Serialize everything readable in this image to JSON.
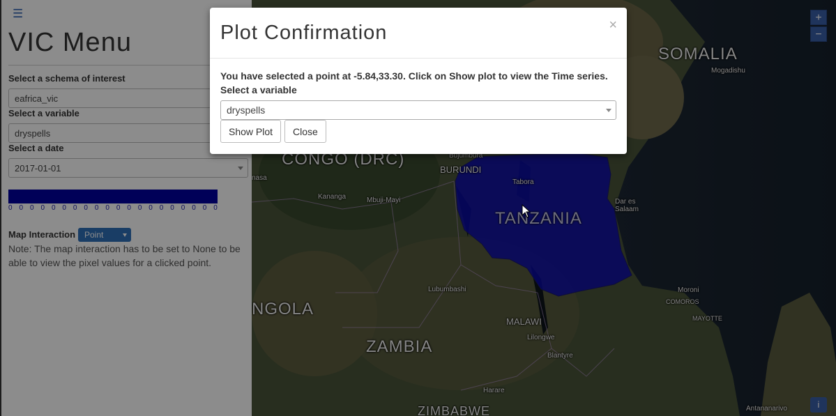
{
  "sidebar": {
    "title": "VIC Menu",
    "schema_label": "Select a schema of interest",
    "schema_value": "eafrica_vic",
    "variable_label": "Select a variable",
    "variable_value": "dryspells",
    "date_label": "Select a date",
    "date_value": "2017-01-01",
    "legend_color": "#0000a0",
    "legend_ticks": [
      "0",
      "0",
      "0",
      "0",
      "0",
      "0",
      "0",
      "0",
      "0",
      "0",
      "0",
      "0",
      "0",
      "0",
      "0",
      "0",
      "0",
      "0",
      "0",
      "0"
    ],
    "map_interaction_label": "Map Interaction",
    "map_interaction_value": "Point",
    "note": "Note: The map interaction has to be set to None to be able to view the pixel values for a clicked point."
  },
  "map": {
    "zoom_in": "+",
    "zoom_out": "−",
    "info": "i",
    "countries": {
      "somalia": "SOMALIA",
      "congo": "CONGO (DRC)",
      "burundi": "BURUNDI",
      "tanzania": "TANZANIA",
      "angola": "NGOLA",
      "zambia": "ZAMBIA",
      "malawi": "MALAWI",
      "comoros": "COMOROS",
      "zimbabwe": "ZIMBABWE"
    },
    "cities": {
      "mogadishu": "Mogadishu",
      "bujumbura": "Bujumbura",
      "tabora": "Tabora",
      "kananga": "Kananga",
      "mbuji_mayi": "Mbuji-Mayi",
      "dar_es_salaam": "Dar es\nSalaam",
      "lubumbashi": "Lubumbashi",
      "lilongwe": "Lilongwe",
      "blantyre": "Blantyre",
      "moroni": "Moroni",
      "mayotte": "MAYOTTE",
      "harare": "Harare",
      "antananarivo": "Antananarivo",
      "nasa": "nasa"
    },
    "highlight_color": "#0a0ab4"
  },
  "modal": {
    "title": "Plot Confirmation",
    "close": "×",
    "message": "You have selected a point at -5.84,33.30. Click on Show plot to view the Time series.",
    "variable_label": "Select a variable",
    "variable_value": "dryspells",
    "show_plot": "Show Plot",
    "close_button": "Close"
  }
}
